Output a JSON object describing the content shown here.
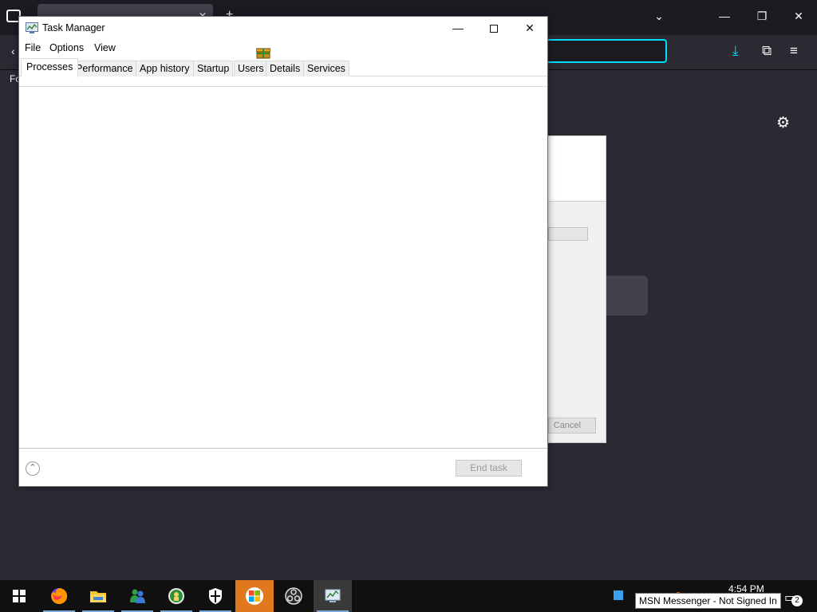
{
  "task_manager": {
    "title": "Task Manager",
    "menu": [
      "File",
      "Options",
      "View"
    ],
    "tabs": [
      "Processes",
      "Performance",
      "App history",
      "Startup",
      "Users",
      "Details",
      "Services"
    ],
    "active_tab": "Processes",
    "end_task_label": "End task"
  },
  "background_dialog": {
    "cancel_label": "Cancel"
  },
  "browser": {
    "bookmarks_fragment": "Fo"
  },
  "taskbar": {
    "clock_time": "4:54 PM",
    "notification_count": "2",
    "tooltip": "MSN Messenger - Not Signed In",
    "apps": [
      "firefox-icon",
      "file-explorer-icon",
      "msn-messenger-icon",
      "xbox-icon",
      "windows-security-icon",
      "windows-xp-logo-icon",
      "obs-icon",
      "task-manager-icon"
    ]
  },
  "colors": {
    "desktop_dark": "#2b2a33",
    "url_focus": "#00ddff",
    "taskbar": "#101010",
    "active_orange": "#e0781e"
  }
}
